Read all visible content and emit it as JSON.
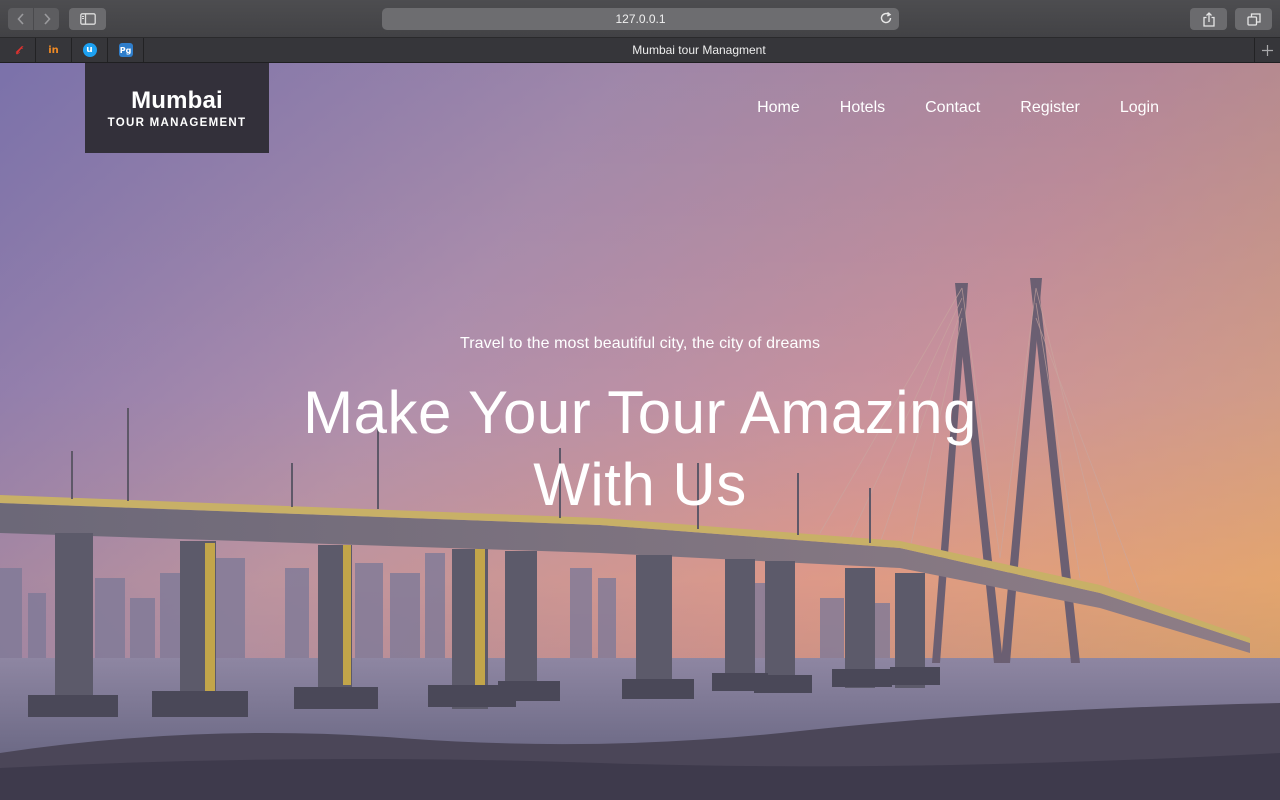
{
  "browser": {
    "address": "127.0.0.1",
    "tab_title": "Mumbai tour Managment",
    "pinned_tabs": [
      {
        "icon": "toolbox-icon",
        "glyph": "t",
        "color": "#e0322f"
      },
      {
        "icon": "invision-icon",
        "glyph": "in",
        "color": "#f08a24"
      },
      {
        "icon": "tweetdeck-icon",
        "glyph": "u",
        "color": "#1da1f2"
      },
      {
        "icon": "pg-icon",
        "glyph": "Pg",
        "color": "#2f7ecb"
      }
    ]
  },
  "site": {
    "brand": {
      "name": "Mumbai",
      "subtitle": "TOUR MANAGEMENT"
    },
    "nav": [
      "Home",
      "Hotels",
      "Contact",
      "Register",
      "Login"
    ],
    "hero": {
      "tagline": "Travel to the most beautiful city, the city of dreams",
      "headline": "Make Your Tour Amazing With Us"
    },
    "colors": {
      "brand_bg": "#33303a",
      "gradient_start": "#7d74a8",
      "gradient_end": "#f0a845"
    }
  }
}
